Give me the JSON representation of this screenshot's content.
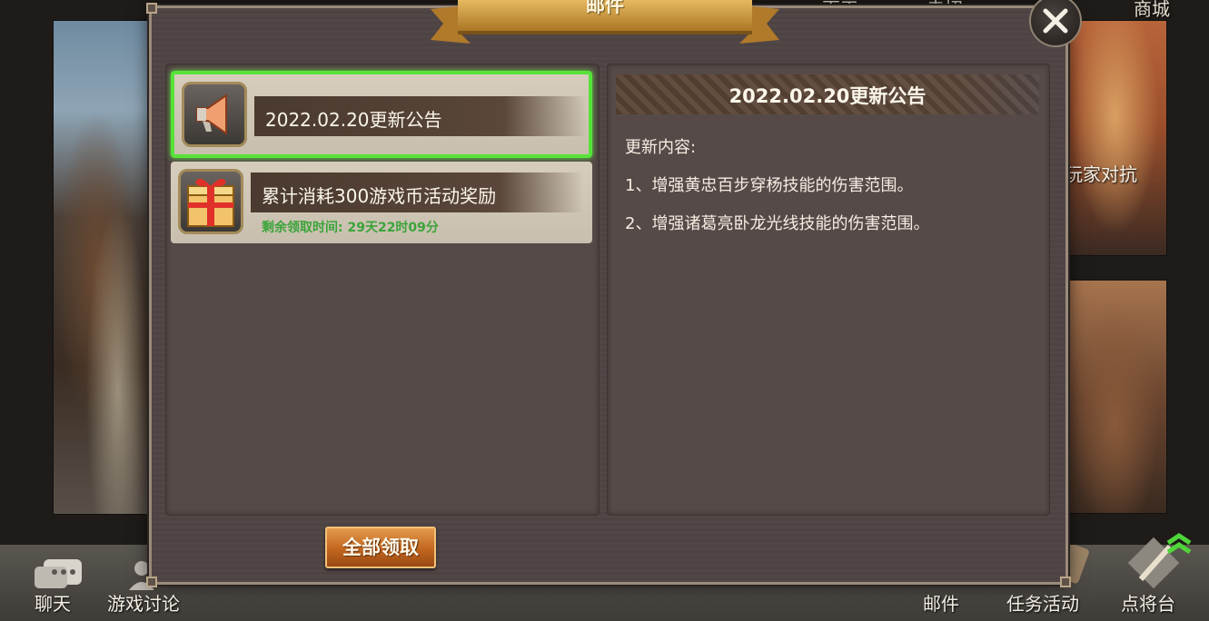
{
  "background": {
    "top_labels": [
      "百王",
      "卖招",
      "商城"
    ],
    "right_card_label": "玩家对抗",
    "bottom_nav": [
      {
        "label": "聊天",
        "icon": "chat-bubble-icon"
      },
      {
        "label": "游戏讨论",
        "icon": "forum-person-icon"
      },
      {
        "label": "邮件",
        "icon": "mail-scroll-icon"
      },
      {
        "label": "任务活动",
        "icon": "quest-scroll-icon"
      },
      {
        "label": "点将台",
        "icon": "sword-banner-icon"
      }
    ]
  },
  "dialog": {
    "title": "邮件",
    "close_icon": "close-x-icon",
    "mail_list": [
      {
        "title": "2022.02.20更新公告",
        "subtitle": "",
        "icon": "megaphone-icon",
        "selected": true
      },
      {
        "title": "累计消耗300游戏币活动奖励",
        "subtitle": "剩余领取时间: 29天22时09分",
        "icon": "gift-box-icon",
        "selected": false
      }
    ],
    "content": {
      "title": "2022.02.20更新公告",
      "lines": [
        "更新内容:",
        "1、增强黄忠百步穿杨技能的伤害范围。",
        "2、增强诸葛亮卧龙光线技能的伤害范围。"
      ]
    },
    "claim_all_label": "全部领取"
  },
  "colors": {
    "selected_border": "#57e23a",
    "timer_text": "#3ba43a",
    "claim_button": "#c2661f",
    "dialog_bg": "#4f4444"
  }
}
